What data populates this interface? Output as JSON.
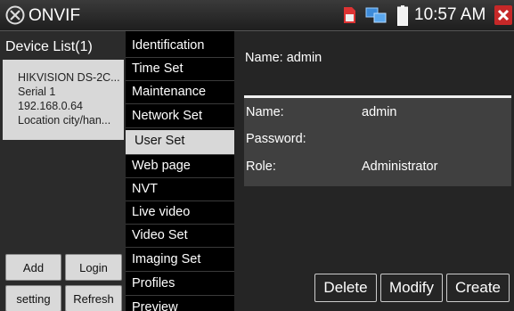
{
  "statusbar": {
    "app_title": "ONVIF",
    "time": "10:57 AM",
    "icons": [
      "onvif-logo-icon",
      "sd-card-icon",
      "network-icon",
      "battery-icon",
      "close-icon"
    ]
  },
  "device_list": {
    "title": "Device List(1)",
    "devices": [
      {
        "model": "HIKVISION DS-2C...",
        "serial": "Serial  1",
        "ip": "192.168.0.64",
        "location": "Location  city/han..."
      }
    ],
    "buttons": {
      "add": "Add",
      "login": "Login",
      "setting": "setting",
      "refresh": "Refresh"
    }
  },
  "menu": {
    "items": [
      "Identification",
      "Time Set",
      "Maintenance",
      "Network Set",
      "User Set",
      "Web page",
      "NVT",
      "Live video",
      "Video Set",
      "Imaging Set",
      "Profiles",
      "Preview"
    ],
    "active": "User Set"
  },
  "user_panel": {
    "header": "Name: admin",
    "rows": [
      {
        "label": "Name:",
        "value": "admin"
      },
      {
        "label": "Password:",
        "value": ""
      },
      {
        "label": "Role:",
        "value": "Administrator"
      }
    ],
    "buttons": {
      "delete": "Delete",
      "modify": "Modify",
      "create": "Create"
    }
  },
  "colors": {
    "close_red": "#c62828",
    "active_menu_bg": "#d8d8d8"
  }
}
